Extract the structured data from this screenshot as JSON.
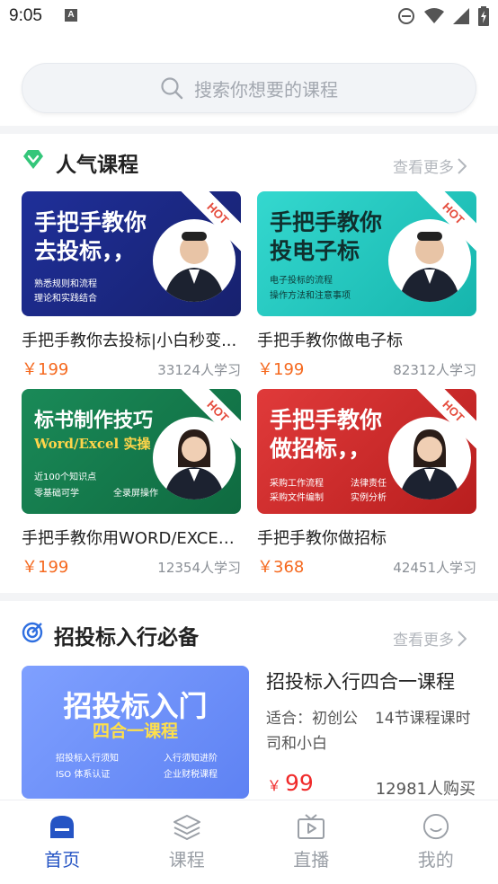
{
  "status_bar": {
    "time": "9:05",
    "notif_glyph": "A"
  },
  "search": {
    "placeholder": "搜索你想要的课程"
  },
  "popular": {
    "title": "人气课程",
    "more": "查看更多",
    "courses": [
      {
        "thumb_title_line1": "手把手教你",
        "thumb_title_line2": "去投标，，",
        "thumb_bullets": [
          "熟悉规则和流程",
          "理论和实践结合"
        ],
        "badge": "HOT",
        "name": "手把手教你去投标|小白秒变...",
        "price": "￥199",
        "learners": "33124人学习",
        "bg": "#1b2a86"
      },
      {
        "thumb_title_line1": "手把手教你",
        "thumb_title_line2": "投电子标",
        "thumb_bullets": [
          "电子投标的流程",
          "操作方法和注意事项"
        ],
        "badge": "HOT",
        "name": "手把手教你做电子标",
        "price": "￥199",
        "learners": "82312人学习",
        "bg": "#22c9c0"
      },
      {
        "thumb_title_line1": "标书制作技巧",
        "thumb_title_line2": "Word/Excel 实操",
        "thumb_bullets": [
          "近100个知识点",
          "零基础可学",
          "全录屏操作"
        ],
        "badge": "HOT",
        "name": "手把手教你用WORD/EXCEL...",
        "price": "￥199",
        "learners": "12354人学习",
        "bg": "#137a4e"
      },
      {
        "thumb_title_line1": "手把手教你",
        "thumb_title_line2": "做招标，，",
        "thumb_bullets": [
          "采购工作流程",
          "法律责任",
          "采购文件编制",
          "实例分析"
        ],
        "badge": "HOT",
        "name": "手把手教你做招标",
        "price": "￥368",
        "learners": "42451人学习",
        "bg": "#d62a2a"
      }
    ]
  },
  "guide": {
    "title": "招投标入行必备",
    "more": "查看更多",
    "feature": {
      "thumb_title": "招投标入门",
      "thumb_subtitle": "四合一课程",
      "thumb_bullets": [
        "招投标入行须知",
        "入行须知进阶",
        "ISO 体系认证",
        "企业财税课程"
      ],
      "title": "招投标入行四合一课程",
      "suit": "适合：初创公司和小白",
      "lessons": "14节课程课时",
      "price_symbol": "￥",
      "price": "99",
      "buyers": "12981人购买"
    }
  },
  "tabs": [
    {
      "label": "首页",
      "icon": "home-icon",
      "active": true
    },
    {
      "label": "课程",
      "icon": "layers-icon",
      "active": false
    },
    {
      "label": "直播",
      "icon": "tv-icon",
      "active": false
    },
    {
      "label": "我的",
      "icon": "smile-icon",
      "active": false
    }
  ],
  "colors": {
    "accent": "#2554c4",
    "price": "#f5691f",
    "feature_price": "#f02b2b"
  }
}
